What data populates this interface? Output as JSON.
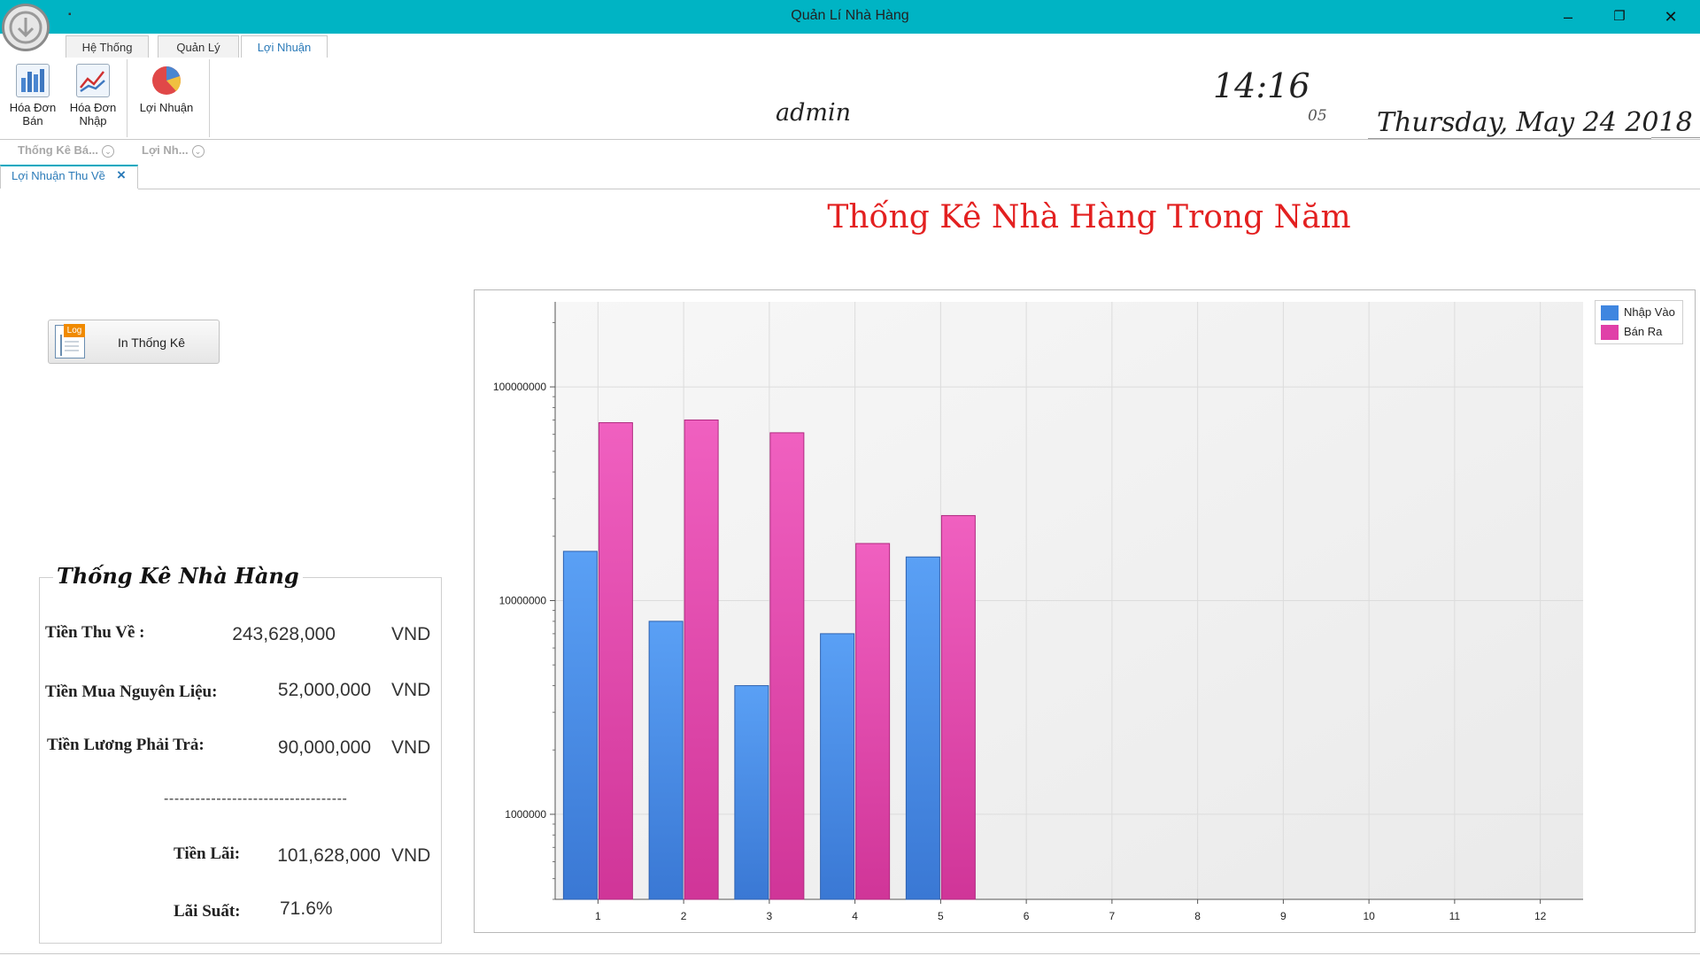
{
  "window": {
    "title": "Quản Lí Nhà Hàng",
    "controls": {
      "minimize": "–",
      "restore": "❐",
      "close": "✕"
    },
    "app_menu_icon": "download-arrow-icon"
  },
  "ribbon": {
    "tabs": [
      "Hệ Thống",
      "Quản Lý",
      "Lợi Nhuận"
    ],
    "active_tab": "Lợi Nhuận",
    "buttons": [
      {
        "label1": "Hóa Đơn",
        "label2": "Bán",
        "icon": "bar-chart-icon"
      },
      {
        "label1": "Hóa Đơn",
        "label2": "Nhập",
        "icon": "line-chart-icon"
      },
      {
        "label1": "Lợi Nhuận",
        "label2": "",
        "icon": "pie-chart-icon"
      }
    ],
    "groups": [
      "Thống Kê Bá...",
      "Lợi Nh..."
    ]
  },
  "header": {
    "user": "admin",
    "time": "14:16",
    "seconds": "05",
    "date": "Thursday,  May 24 2018"
  },
  "doc_tab": {
    "label": "Lợi Nhuận Thu Về",
    "close": "×"
  },
  "main": {
    "title": "Thống Kê Nhà Hàng Trong Năm",
    "print_button": "In Thống Kê",
    "print_icon_tag": "Log"
  },
  "stats": {
    "title": "Thống Kê Nhà Hàng",
    "rows": [
      {
        "label": "Tiền Thu Về :",
        "value": "243,628,000",
        "unit": "VND"
      },
      {
        "label": "Tiền Mua Nguyên Liệu:",
        "value": "52,000,000",
        "unit": "VND"
      },
      {
        "label": "Tiền Lương Phải Trả:",
        "value": "90,000,000",
        "unit": "VND"
      }
    ],
    "separator": "-----------------------------------",
    "profit": {
      "label": "Tiền Lãi:",
      "value": "101,628,000",
      "unit": "VND"
    },
    "rate": {
      "label": "Lãi Suất:",
      "value": "71.6%"
    }
  },
  "chart_data": {
    "type": "bar",
    "y_scale": "log",
    "ylim": [
      400000,
      250000000
    ],
    "yticks": [
      1000000,
      10000000,
      100000000
    ],
    "ytick_labels": [
      "1000000",
      "10000000",
      "100000000"
    ],
    "categories": [
      "1",
      "2",
      "3",
      "4",
      "5",
      "6",
      "7",
      "8",
      "9",
      "10",
      "11",
      "12"
    ],
    "series": [
      {
        "name": "Nhập Vào",
        "color": "#3f86e0",
        "values": [
          17000000,
          8000000,
          4000000,
          7000000,
          16000000,
          null,
          null,
          null,
          null,
          null,
          null,
          null
        ]
      },
      {
        "name": "Bán Ra",
        "color": "#e040a8",
        "values": [
          68000000,
          70000000,
          61000000,
          18500000,
          25000000,
          null,
          null,
          null,
          null,
          null,
          null,
          null
        ]
      }
    ],
    "legend_position": "top-right",
    "grid": true
  }
}
